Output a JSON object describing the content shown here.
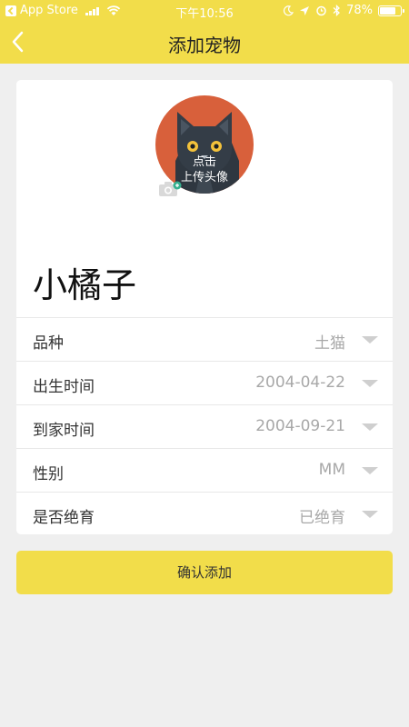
{
  "status_bar": {
    "back_app": "App Store",
    "time": "下午10:56",
    "battery": "78%",
    "battery_level": 0.78
  },
  "nav": {
    "title": "添加宠物",
    "back_icon": "chevron-left-icon"
  },
  "avatar": {
    "line1": "点击",
    "line2": "上传头像",
    "icon": "camera-icon"
  },
  "pet_name": "小橘子",
  "fields": [
    {
      "label": "品种",
      "value": "土猫"
    },
    {
      "label": "出生时间",
      "value": "2004-04-22"
    },
    {
      "label": "到家时间",
      "value": "2004-09-21"
    },
    {
      "label": "性别",
      "value": "MM"
    },
    {
      "label": "是否绝育",
      "value": "已绝育"
    }
  ],
  "confirm_label": "确认添加",
  "colors": {
    "accent": "#f2dd4a",
    "avatar_bg": "#d8603b"
  }
}
